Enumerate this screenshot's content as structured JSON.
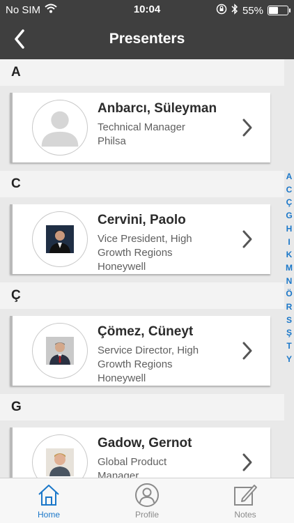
{
  "status_bar": {
    "carrier": "No SIM",
    "time": "10:04",
    "battery": "55%",
    "battery_level": 0.55
  },
  "nav": {
    "title": "Presenters"
  },
  "sections": [
    {
      "letter": "A",
      "presenters": [
        {
          "name": "Anbarcı, Süleyman",
          "lines": [
            "Technical Manager",
            "Philsa"
          ],
          "photo": "placeholder"
        }
      ]
    },
    {
      "letter": "C",
      "presenters": [
        {
          "name": "Cervini, Paolo",
          "lines": [
            "Vice President, High",
            "Growth Regions",
            "Honeywell"
          ],
          "photo": "dark-suit"
        }
      ]
    },
    {
      "letter": "Ç",
      "presenters": [
        {
          "name": "Çömez, Cüneyt",
          "lines": [
            "Service Director, High",
            "Growth Regions",
            "Honeywell"
          ],
          "photo": "suit-red-tie"
        }
      ]
    },
    {
      "letter": "G",
      "presenters": [
        {
          "name": "Gadow, Gernot",
          "lines": [
            "Global Product",
            "Manager"
          ],
          "photo": "blond"
        }
      ]
    }
  ],
  "index_letters": [
    "A",
    "C",
    "Ç",
    "G",
    "H",
    "I",
    "K",
    "M",
    "N",
    "Ö",
    "R",
    "S",
    "Ş",
    "T",
    "Y"
  ],
  "tabs": [
    {
      "label": "Home",
      "icon": "home-icon",
      "active": true
    },
    {
      "label": "Profile",
      "icon": "profile-icon",
      "active": false
    },
    {
      "label": "Notes",
      "icon": "notes-icon",
      "active": false
    }
  ],
  "colors": {
    "header_bg": "#3f3f3f",
    "accent": "#1a77c9",
    "inactive_tab": "#8a8a8a"
  }
}
